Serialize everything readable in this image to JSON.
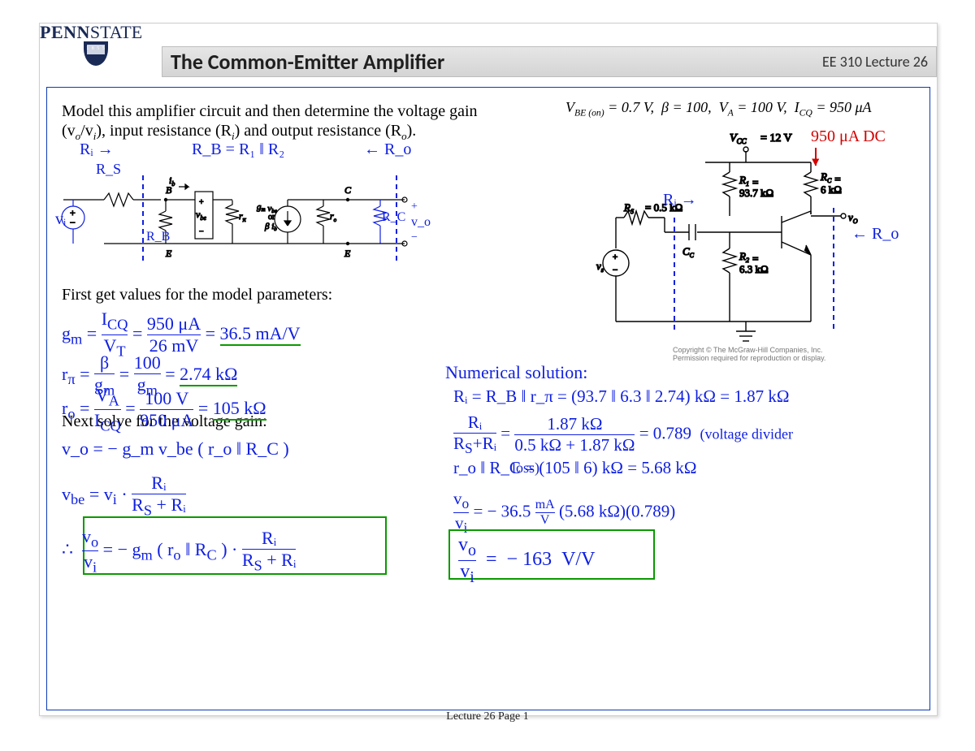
{
  "header": {
    "logo_main": "PENN",
    "logo_thin": "STATE",
    "shield_year": "1 8 5 5",
    "title": "The Common-Emitter Amplifier",
    "course": "EE 310 Lecture 26"
  },
  "problem": {
    "line1": "Model this amplifier circuit and then determine the voltage gain",
    "line2_a": "(v",
    "line2_b": "/v",
    "line2_c": "), input resistance (R",
    "line2_d": ") and output resistance (R",
    "line2_e": ").",
    "sub_o": "o",
    "sub_i": "i",
    "params": "V_BE (on) = 0.7 V, β = 100, V_A = 100 V, I_CQ = 950 μA"
  },
  "schematic_small": {
    "Ri": "Rᵢ →",
    "RB": "R_B = R₁ ‖ R₂",
    "Ro": "← R_o",
    "labels": {
      "ib": "i_b",
      "vbe": "v_be",
      "rpi": "r_π",
      "src": "g_m v_be\nor\nβ i_b",
      "ro": "r_o",
      "Rc": "R_C",
      "vo": "v_o",
      "vi": "v_i",
      "Rs": "R_S",
      "RB_el": "R_B",
      "B": "B",
      "C": "C",
      "E": "E"
    }
  },
  "schematic_big": {
    "Vcc": "V_CC = 12 V",
    "R1": "R₁ =\n93.7 kΩ",
    "R2": "R₂ =\n6.3 kΩ",
    "RC": "R_C =\n6 kΩ",
    "RS": "R_S = 0.5 kΩ",
    "CC": "C_C",
    "vs": "v_s",
    "vo": "v_O",
    "copyright": "Copyright © The McGraw-Hill Companies, Inc. Permission required for reproduction or display."
  },
  "handwriting": {
    "Ri_arrow": "Rᵢ →",
    "Ro_arrow": "← R_o",
    "I_dc": "950 μA  DC",
    "gm_line": "g_m = I_CQ / V_T = 950 μA / 26 mV = 36.5 mA/V",
    "rpi_line": "r_π = β / g_m = 100 / g_m = 2.74 kΩ",
    "ro_line": "r_o = V_A / I_CQ = 100 V / 950 μA = 105 kΩ",
    "gain_eq1": "v_o = − g_m v_be ( r_o ‖ R_C )",
    "gain_eq2": "v_be = v_i · Rᵢ / ( R_S + Rᵢ )",
    "gain_box": "∴  v_o / v_i = − g_m ( r_o ‖ R_C ) · Rᵢ / ( R_S + Rᵢ )",
    "num_title": "Numerical solution:",
    "num_Ri": "Rᵢ = R_B ‖ r_π = (93.7 ‖ 6.3 ‖ 2.74) kΩ = 1.87 kΩ",
    "num_div": "Rᵢ / (R_S + Rᵢ) = 1.87 kΩ / (0.5 kΩ + 1.87 kΩ) = 0.789  (voltage divider loss)",
    "num_roRc": "r_o ‖ R_C = (105 ‖ 6) kΩ = 5.68 kΩ",
    "num_calc": "v_o / v_i = − 36.5 mA/V · (5.68 kΩ) (0.789)",
    "num_result": "v_o / v_i  =  − 163  V/V"
  },
  "printed": {
    "first_get": "First get values for the model parameters:",
    "next_solve": "Next solve for the voltage gain:"
  },
  "footer": "Lecture 26 Page 1"
}
